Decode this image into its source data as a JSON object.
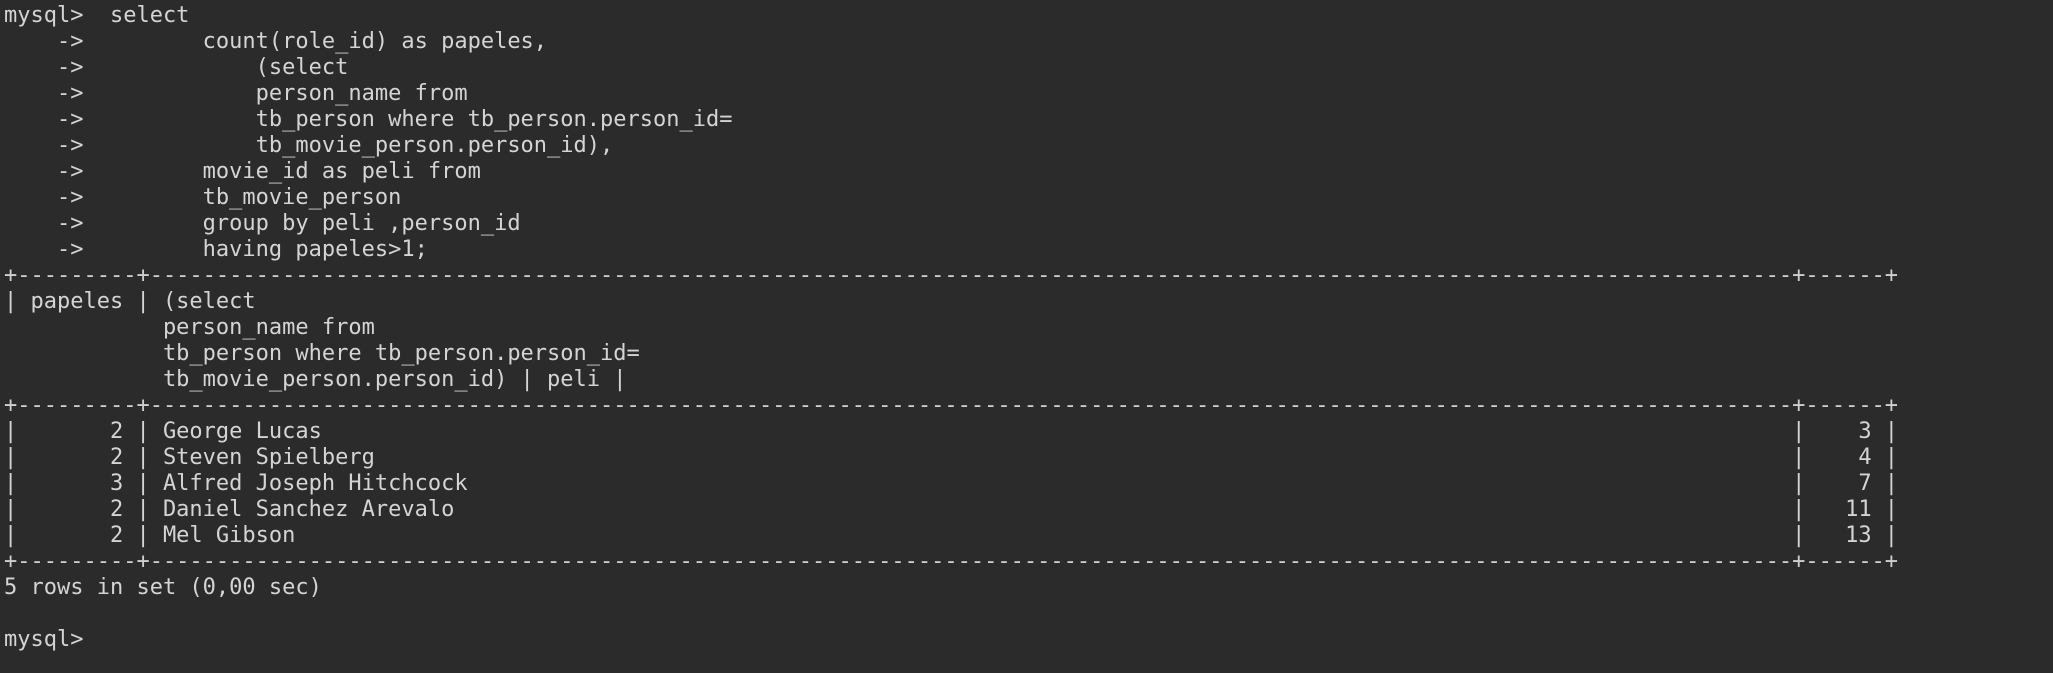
{
  "terminal": {
    "colors": {
      "background": "#2b2b2b",
      "text": "#d4d4d4"
    },
    "lines": [
      "mysql>  select",
      "    ->         count(role_id) as papeles,",
      "    ->             (select",
      "    ->             person_name from",
      "    ->             tb_person where tb_person.person_id=",
      "    ->             tb_movie_person.person_id),",
      "    ->         movie_id as peli from",
      "    ->         tb_movie_person",
      "    ->         group by peli ,person_id",
      "    ->         having papeles>1;",
      "+---------+----------------------------------------------------------------------------------------------------------------------------+------+",
      "| papeles | (select",
      "            person_name from",
      "            tb_person where tb_person.person_id=",
      "            tb_movie_person.person_id) | peli |",
      "+---------+----------------------------------------------------------------------------------------------------------------------------+------+",
      "|       2 | George Lucas                                                                                                               |    3 |",
      "|       2 | Steven Spielberg                                                                                                           |    4 |",
      "|       3 | Alfred Joseph Hitchcock                                                                                                    |    7 |",
      "|       2 | Daniel Sanchez Arevalo                                                                                                     |   11 |",
      "|       2 | Mel Gibson                                                                                                                 |   13 |",
      "+---------+----------------------------------------------------------------------------------------------------------------------------+------+",
      "5 rows in set (0,00 sec)",
      "",
      "mysql> "
    ]
  }
}
